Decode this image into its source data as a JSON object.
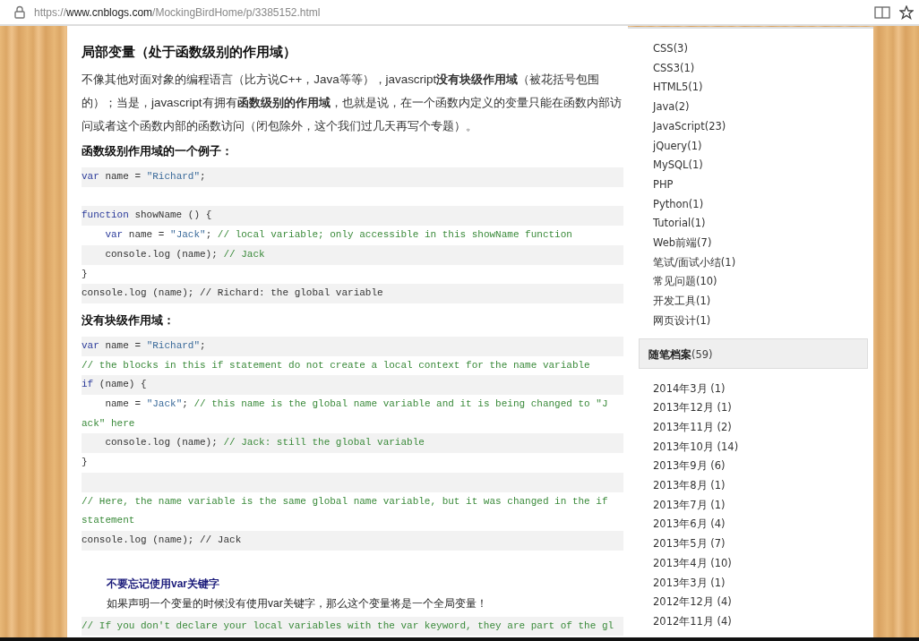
{
  "address_bar": {
    "url_prefix": "https://",
    "url_host": "www.cnblogs.com",
    "url_path": "/MockingBirdHome/p/3385152.html"
  },
  "article": {
    "heading": "局部变量（处于函数级别的作用域）",
    "paragraph": "不像其他对面对象的编程语言（比方说C++，Java等等），javascript**没有块级作用域**（被花括号包围的）；当是，javascript有拥有**函数级别的作用域**，也就是说，在一个函数内定义的变量只能在函数内部访问或者这个函数内部的函数访问（闭包除外，这个我们过几天再写个专题）。",
    "blocks": [
      {
        "kind": "subheading",
        "text": "函数级别作用域的一个例子："
      },
      {
        "kind": "code",
        "lines": [
          {
            "shaded": true,
            "tokens": [
              {
                "kind": "keyword",
                "t": "var"
              },
              {
                "kind": "plain",
                "t": " name = "
              },
              {
                "kind": "string",
                "t": "\"Richard\""
              },
              {
                "kind": "plain",
                "t": ";"
              }
            ]
          },
          {
            "shaded": false
          },
          {
            "shaded": true,
            "tokens": [
              {
                "kind": "keyword",
                "t": "function"
              },
              {
                "kind": "plain",
                "t": " showName () {"
              }
            ]
          },
          {
            "shaded": false,
            "tokens": [
              {
                "kind": "keyword",
                "t": "    var"
              },
              {
                "kind": "plain",
                "t": " name = "
              },
              {
                "kind": "string",
                "t": "\"Jack\""
              },
              {
                "kind": "plain",
                "t": "; "
              },
              {
                "kind": "comment",
                "t": "// local variable; only accessible in this showName function"
              }
            ]
          },
          {
            "shaded": true,
            "tokens": [
              {
                "kind": "plain",
                "t": "    console.log (name); "
              },
              {
                "kind": "comment",
                "t": "// Jack"
              }
            ]
          },
          {
            "shaded": false,
            "tokens": [
              {
                "kind": "plain",
                "t": "}"
              }
            ]
          },
          {
            "shaded": true,
            "tokens": [
              {
                "kind": "plain",
                "t": "console.log (name); // Richard: the global variable"
              }
            ]
          }
        ]
      },
      {
        "kind": "subheading",
        "text": "没有块级作用域："
      },
      {
        "kind": "code",
        "lines": [
          {
            "shaded": true,
            "tokens": [
              {
                "kind": "keyword",
                "t": "var"
              },
              {
                "kind": "plain",
                "t": " name = "
              },
              {
                "kind": "string",
                "t": "\"Richard\""
              },
              {
                "kind": "plain",
                "t": ";"
              }
            ]
          },
          {
            "shaded": false,
            "tokens": [
              {
                "kind": "comment",
                "t": "// the blocks in this if statement do not create a local context for the name variable"
              }
            ]
          },
          {
            "shaded": true,
            "tokens": [
              {
                "kind": "keyword",
                "t": "if"
              },
              {
                "kind": "plain",
                "t": " (name) {"
              }
            ]
          },
          {
            "shaded": false,
            "tokens": [
              {
                "kind": "plain",
                "t": "    name = "
              },
              {
                "kind": "string",
                "t": "\"Jack\""
              },
              {
                "kind": "plain",
                "t": "; "
              },
              {
                "kind": "comment",
                "t": "// this name is the global name variable and it is being changed to \"Jack\" here"
              }
            ]
          },
          {
            "shaded": true,
            "tokens": [
              {
                "kind": "plain",
                "t": "    console.log (name); "
              },
              {
                "kind": "comment",
                "t": "// Jack: still the global variable"
              }
            ]
          },
          {
            "shaded": false,
            "tokens": [
              {
                "kind": "plain",
                "t": "}"
              }
            ]
          },
          {
            "shaded": true
          },
          {
            "shaded": false,
            "tokens": [
              {
                "kind": "comment",
                "t": "// Here, the name variable is the same global name variable, but it was changed in the if statement"
              }
            ]
          },
          {
            "shaded": true,
            "tokens": [
              {
                "kind": "plain",
                "t": "console.log (name); // Jack"
              }
            ]
          }
        ]
      },
      {
        "kind": "note",
        "title": "不要忘记使用var关键字",
        "text": "如果声明一个变量的时候没有使用var关键字，那么这个变量将是一个全局变量！"
      },
      {
        "kind": "code",
        "lines": [
          {
            "shaded": true,
            "tokens": [
              {
                "kind": "comment",
                "t": "// If you don't declare your local variables with the var keyword, they are part of the gl"
              }
            ]
          }
        ]
      }
    ]
  },
  "sidebar": {
    "categories": [
      "CSS(3)",
      "CSS3(1)",
      "HTML5(1)",
      "Java(2)",
      "JavaScript(23)",
      "jQuery(1)",
      "MySQL(1)",
      "PHP",
      "Python(1)",
      "Tutorial(1)",
      "Web前端(7)",
      "笔试/面试小结(1)",
      "常见问题(10)",
      "开发工具(1)",
      "网页设计(1)"
    ],
    "archive": {
      "title": "随笔档案",
      "count": "(59)",
      "items": [
        "2014年3月 (1)",
        "2013年12月 (1)",
        "2013年11月 (2)",
        "2013年10月 (14)",
        "2013年9月 (6)",
        "2013年8月 (1)",
        "2013年7月 (1)",
        "2013年6月 (4)",
        "2013年5月 (7)",
        "2013年4月 (10)",
        "2013年3月 (1)",
        "2012年12月 (4)",
        "2012年11月 (4)"
      ]
    }
  }
}
